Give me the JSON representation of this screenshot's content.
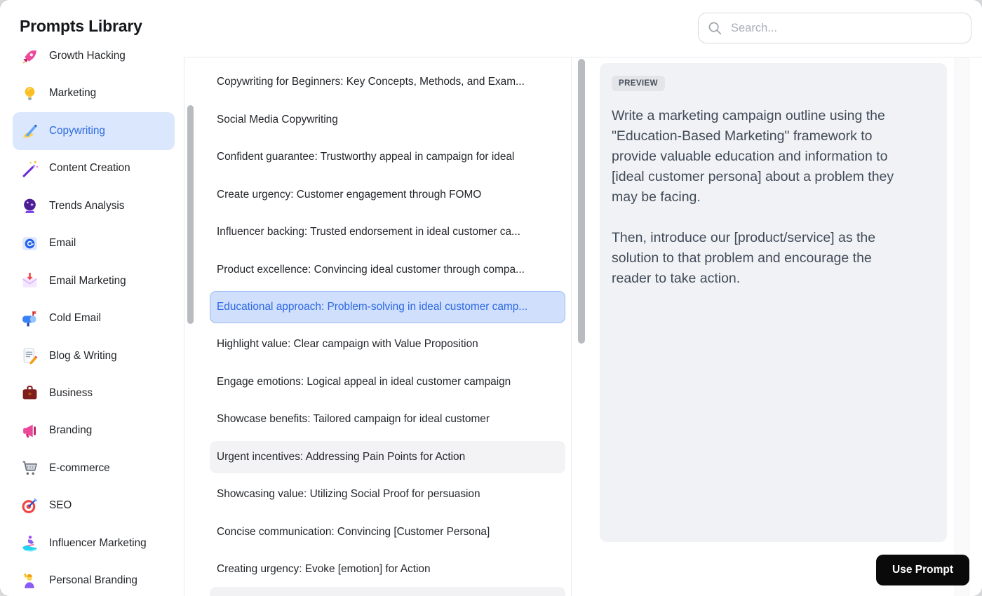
{
  "window": {
    "title": "Prompts Library"
  },
  "search": {
    "placeholder": "Search...",
    "icon": "search-icon"
  },
  "sidebar": {
    "items": [
      {
        "label": "Growth Hacking",
        "icon": "rocket-icon"
      },
      {
        "label": "Marketing",
        "icon": "lightbulb-icon"
      },
      {
        "label": "Copywriting",
        "icon": "writing-hand-icon",
        "state": "selected"
      },
      {
        "label": "Content Creation",
        "icon": "magic-wand-icon"
      },
      {
        "label": "Trends Analysis",
        "icon": "crystal-ball-icon"
      },
      {
        "label": "Email",
        "icon": "email-icon"
      },
      {
        "label": "Email Marketing",
        "icon": "envelope-arrow-icon"
      },
      {
        "label": "Cold Email",
        "icon": "mailbox-icon"
      },
      {
        "label": "Blog & Writing",
        "icon": "memo-pencil-icon"
      },
      {
        "label": "Business",
        "icon": "briefcase-icon"
      },
      {
        "label": "Branding",
        "icon": "megaphone-icon"
      },
      {
        "label": "E-commerce",
        "icon": "shopping-cart-icon"
      },
      {
        "label": "SEO",
        "icon": "target-icon"
      },
      {
        "label": "Influencer Marketing",
        "icon": "surfer-icon"
      },
      {
        "label": "Personal Branding",
        "icon": "raising-hand-icon"
      }
    ]
  },
  "prompt_list": {
    "items": [
      {
        "label": "Copywriting for Beginners: Key Concepts, Methods, and Exam..."
      },
      {
        "label": "Social Media Copywriting"
      },
      {
        "label": "Confident guarantee: Trustworthy appeal in campaign for ideal"
      },
      {
        "label": "Create urgency: Customer engagement through FOMO"
      },
      {
        "label": "Influencer backing: Trusted endorsement in ideal customer ca..."
      },
      {
        "label": "Product excellence: Convincing ideal customer through compa..."
      },
      {
        "label": "Educational approach: Problem-solving in ideal customer camp...",
        "state": "selected"
      },
      {
        "label": "Highlight value: Clear campaign with Value Proposition"
      },
      {
        "label": "Engage emotions: Logical appeal in ideal customer campaign"
      },
      {
        "label": "Showcase benefits: Tailored campaign for ideal customer"
      },
      {
        "label": "Urgent incentives: Addressing Pain Points for Action",
        "state": "hover"
      },
      {
        "label": "Showcasing value: Utilizing Social Proof for persuasion"
      },
      {
        "label": "Concise communication: Convincing [Customer Persona]"
      },
      {
        "label": "Creating urgency: Evoke [emotion] for Action"
      }
    ]
  },
  "preview": {
    "badge_label": "PREVIEW",
    "paragraphs": [
      "Write a marketing campaign outline using the \"Education-Based Marketing\" framework to provide valuable education and information to [ideal customer persona] about a problem they may be facing.",
      "Then, introduce our [product/service] as the solution to that problem and encourage the reader to take action."
    ]
  },
  "actions": {
    "use_prompt_label": "Use Prompt"
  },
  "colors": {
    "accent_blue": "#2b67e2",
    "list_selected_bg": "#cfdffc",
    "list_selected_border": "#9cbbf5",
    "sidebar_selected_bg": "#dbe7fd",
    "hover_bg": "#f3f3f5",
    "preview_card_bg": "#f1f2f5",
    "button_bg": "#0a0a0b"
  }
}
